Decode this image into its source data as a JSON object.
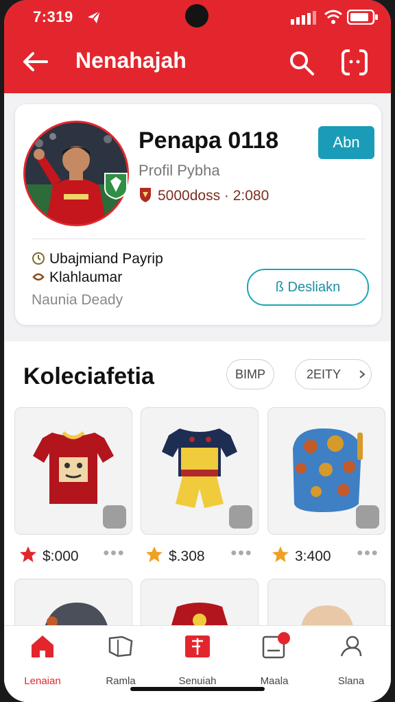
{
  "status": {
    "time": "7:319"
  },
  "appbar": {
    "title": "Nenahajah"
  },
  "profile": {
    "name": "Penapa  0118",
    "subtitle": "Profil Pybha",
    "stats": "5000doss · 2:080",
    "follow_label": "Abn",
    "info_line1": "Ubajmiand Payrip",
    "info_line2": "Klahlaumar",
    "info_line3": "Naunia Deady",
    "description_button": "ß Desliakn"
  },
  "collection": {
    "title": "Koleciafetia",
    "filter1": "BIMP",
    "filter2": "2EITY",
    "items": [
      {
        "price": "$:000",
        "accent": "#e3262d"
      },
      {
        "price": "$.308",
        "accent": "#f0a020"
      },
      {
        "price": "3:400",
        "accent": "#f0a020"
      }
    ]
  },
  "nav": {
    "items": [
      {
        "label": "Lenaian"
      },
      {
        "label": "Ramla"
      },
      {
        "label": "Senuiah"
      },
      {
        "label": "Maala"
      },
      {
        "label": "Slana"
      }
    ],
    "badge": "1"
  },
  "colors": {
    "brand": "#e3262d",
    "accent": "#1a9cb8"
  }
}
